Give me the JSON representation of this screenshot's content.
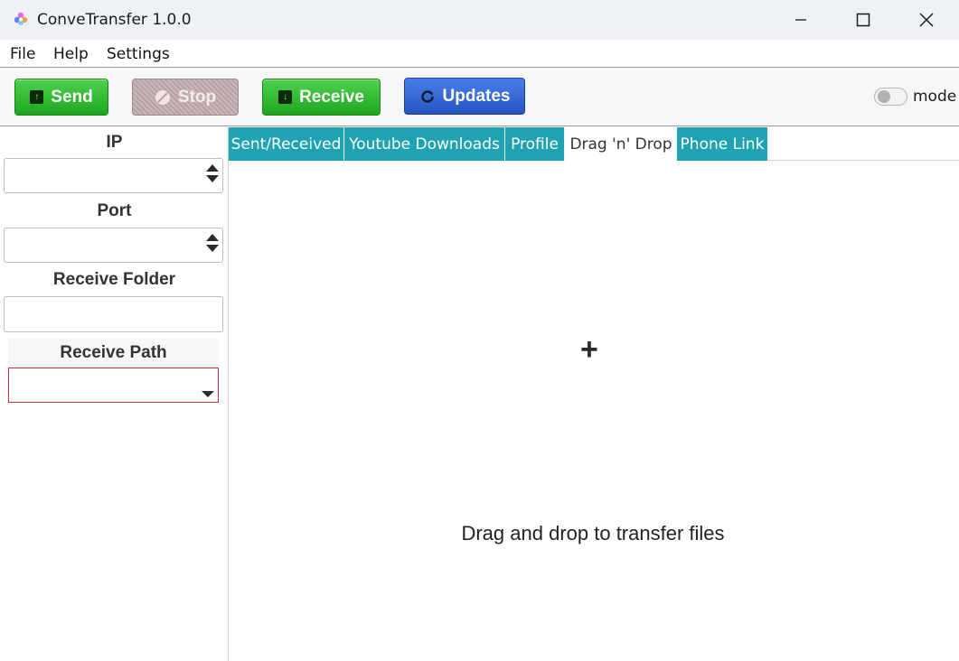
{
  "window": {
    "title": "ConveTransfer 1.0.0",
    "controls": {
      "minimize": "minimize-icon",
      "maximize": "maximize-icon",
      "close": "close-icon"
    }
  },
  "menu": {
    "file": "File",
    "help": "Help",
    "settings": "Settings"
  },
  "toolbar": {
    "send_label": "Send",
    "stop_label": "Stop",
    "receive_label": "Receive",
    "updates_label": "Updates",
    "mode_label": "mode",
    "mode_on": false
  },
  "sidebar": {
    "ip_label": "IP",
    "ip_value": "",
    "port_label": "Port",
    "port_value": "",
    "receive_folder_label": "Receive Folder",
    "receive_folder_value": "",
    "receive_path_label": "Receive Path",
    "receive_path_value": ""
  },
  "tabs": [
    {
      "label": "Sent/Received",
      "active": false
    },
    {
      "label": "Youtube Downloads",
      "active": false
    },
    {
      "label": "Profile",
      "active": false
    },
    {
      "label": "Drag 'n' Drop",
      "active": true
    },
    {
      "label": "Phone Link",
      "active": false
    }
  ],
  "main": {
    "plus_symbol": "+",
    "drop_text": "Drag and drop to transfer files"
  },
  "colors": {
    "tab_bg": "#1fa3b3",
    "green_button": "#2fbe2f",
    "blue_button": "#2f63d6",
    "stop_button": "#c2aeb0",
    "path_border": "#c73535"
  }
}
